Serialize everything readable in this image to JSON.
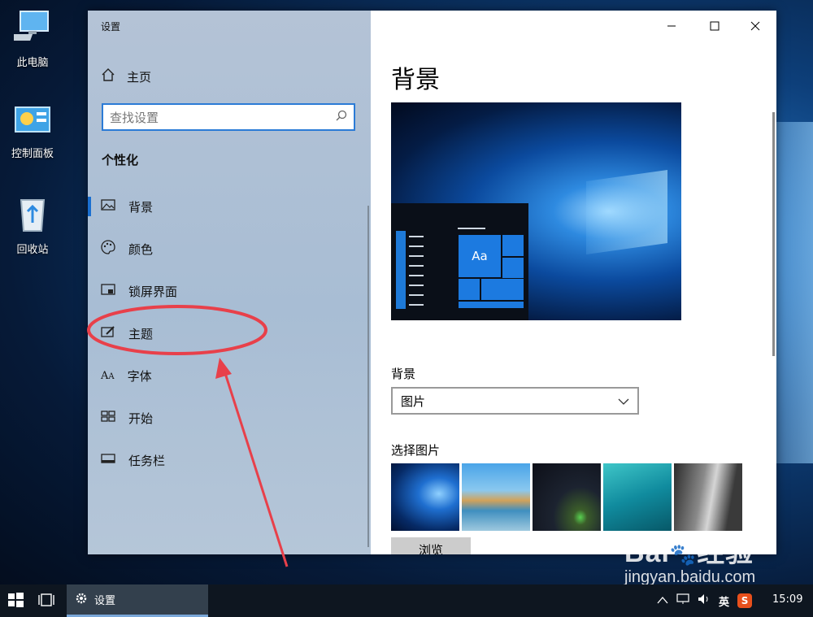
{
  "desktop": {
    "icons": [
      {
        "label": "此电脑",
        "icon": "computer-icon"
      },
      {
        "label": "控制面板",
        "icon": "control-panel-icon"
      },
      {
        "label": "回收站",
        "icon": "recycle-bin-icon"
      }
    ]
  },
  "window": {
    "app_title": "设置",
    "controls": {
      "minimize": "—",
      "maximize": "☐",
      "close": "✕"
    }
  },
  "sidebar": {
    "home_label": "主页",
    "search": {
      "placeholder": "查找设置",
      "icon": "search-icon"
    },
    "section_title": "个性化",
    "items": [
      {
        "label": "背景",
        "icon": "picture-icon",
        "active": true
      },
      {
        "label": "颜色",
        "icon": "palette-icon"
      },
      {
        "label": "锁屏界面",
        "icon": "lock-screen-icon"
      },
      {
        "label": "主题",
        "icon": "theme-brush-icon"
      },
      {
        "label": "字体",
        "icon": "font-icon"
      },
      {
        "label": "开始",
        "icon": "start-tiles-icon"
      },
      {
        "label": "任务栏",
        "icon": "taskbar-icon"
      }
    ]
  },
  "content": {
    "title": "背景",
    "preview_tile_text": "Aa",
    "background_label": "背景",
    "background_select": {
      "value": "图片"
    },
    "choose_picture_label": "选择图片",
    "browse_label": "浏览"
  },
  "taskbar": {
    "app_label": "设置",
    "ime_label": "英",
    "clock": "15:09"
  },
  "watermark": {
    "brand": "Baidu经验",
    "url": "jingyan.baidu.com"
  },
  "colors": {
    "accent": "#1a6fd0",
    "annotation": "#e8404a"
  }
}
